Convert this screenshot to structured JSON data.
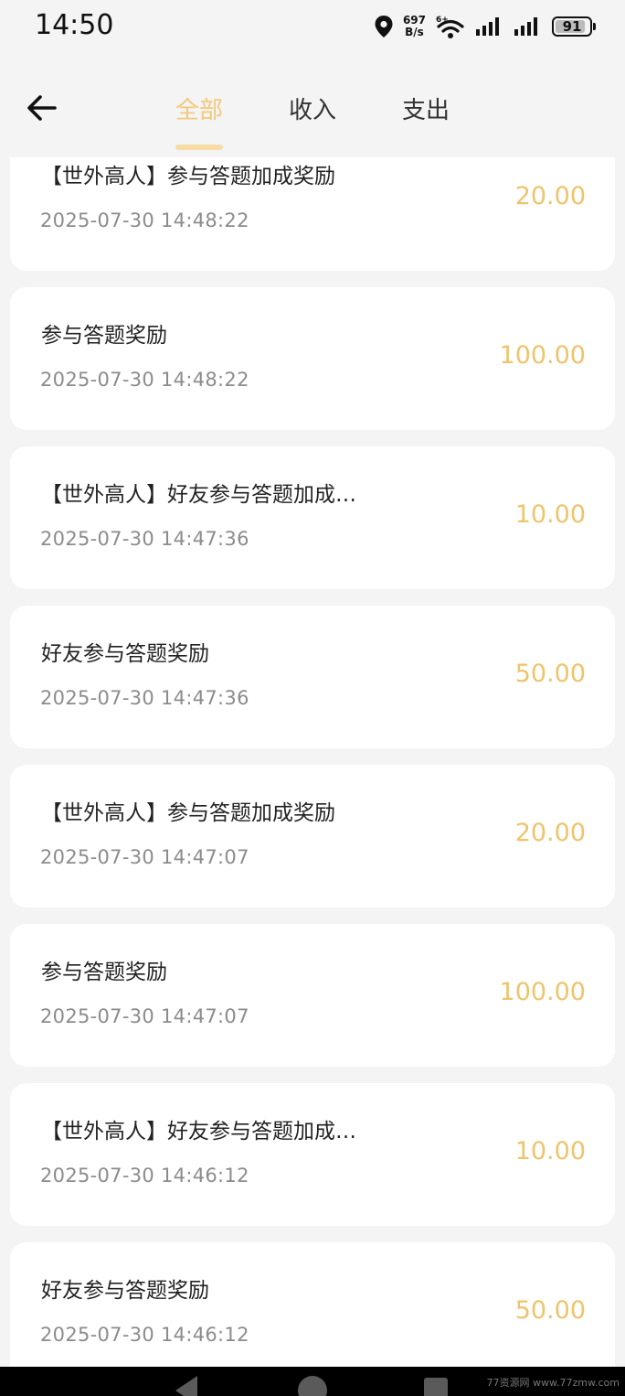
{
  "status_bar": {
    "time": "14:50",
    "net_speed_value": "697",
    "net_speed_unit": "B/s",
    "battery": "91",
    "battery_level": 0.91
  },
  "tabs": [
    {
      "label": "全部",
      "active": true
    },
    {
      "label": "收入",
      "active": false
    },
    {
      "label": "支出",
      "active": false
    }
  ],
  "records": [
    {
      "title": "【世外高人】参与答题加成奖励",
      "time": "2025-07-30 14:48:22",
      "amount": "20.00"
    },
    {
      "title": "参与答题奖励",
      "time": "2025-07-30 14:48:22",
      "amount": "100.00"
    },
    {
      "title": "【世外高人】好友参与答题加成…",
      "time": "2025-07-30 14:47:36",
      "amount": "10.00"
    },
    {
      "title": "好友参与答题奖励",
      "time": "2025-07-30 14:47:36",
      "amount": "50.00"
    },
    {
      "title": "【世外高人】参与答题加成奖励",
      "time": "2025-07-30 14:47:07",
      "amount": "20.00"
    },
    {
      "title": "参与答题奖励",
      "time": "2025-07-30 14:47:07",
      "amount": "100.00"
    },
    {
      "title": "【世外高人】好友参与答题加成…",
      "time": "2025-07-30 14:46:12",
      "amount": "10.00"
    },
    {
      "title": "好友参与答题奖励",
      "time": "2025-07-30 14:46:12",
      "amount": "50.00"
    }
  ],
  "watermark": "77资源网 www.77zmw.com",
  "colors": {
    "accent": "#f2c97a",
    "amount": "#eec46c",
    "background": "#f4f4f4",
    "card": "#ffffff"
  }
}
